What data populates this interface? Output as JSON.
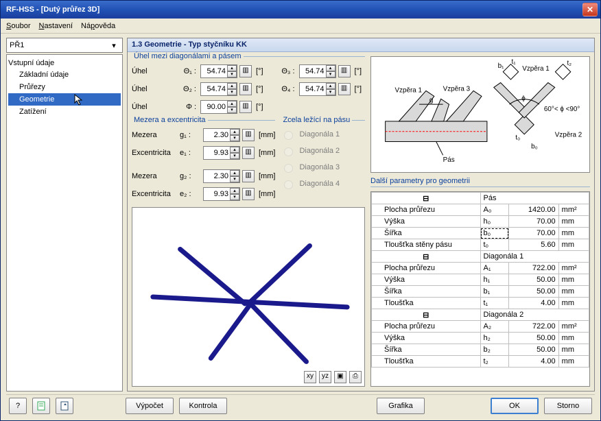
{
  "window": {
    "title": "RF-HSS - [Dutý průřez 3D]"
  },
  "menu": {
    "file": "Soubor",
    "settings": "Nastavení",
    "help": "Nápověda"
  },
  "case_selector": "PŘ1",
  "header": "1.3 Geometrie - Typ styčníku KK",
  "tree": {
    "root": "Vstupní údaje",
    "items": [
      "Základní údaje",
      "Průřezy",
      "Geometrie",
      "Zatížení"
    ],
    "selected": "Geometrie"
  },
  "angles": {
    "title": "Úhel mezi diagonálami a pásem",
    "lbl": "Úhel",
    "unit": "[°]",
    "theta1": {
      "sym": "Θ₁ :",
      "val": "54.74"
    },
    "theta2": {
      "sym": "Θ₂ :",
      "val": "54.74"
    },
    "theta3": {
      "sym": "Θ₃ :",
      "val": "54.74"
    },
    "theta4": {
      "sym": "Θ₄ :",
      "val": "54.74"
    },
    "phi": {
      "sym": "Φ :",
      "val": "90.00"
    }
  },
  "gap": {
    "title": "Mezera a excentricita",
    "rows": [
      {
        "lbl": "Mezera",
        "sym": "g₁ :",
        "val": "2.30",
        "unit": "[mm]"
      },
      {
        "lbl": "Excentricita",
        "sym": "e₁ :",
        "val": "9.93",
        "unit": "[mm]"
      },
      {
        "lbl": "Mezera",
        "sym": "g₂ :",
        "val": "2.30",
        "unit": "[mm]"
      },
      {
        "lbl": "Excentricita",
        "sym": "e₂ :",
        "val": "9.93",
        "unit": "[mm]"
      }
    ]
  },
  "zcela": {
    "title": "Zcela ležící na pásu",
    "opts": [
      "Diagonála 1",
      "Diagonála 2",
      "Diagonála 3",
      "Diagonála 4"
    ]
  },
  "diagram": {
    "vzpera1": "Vzpěra 1",
    "vzpera2": "Vzpěra 2",
    "vzpera3": "Vzpěra 3",
    "pas": "Pás",
    "b0": "b₀",
    "t0": "t₀",
    "b1": "b₁",
    "t1": "t₁",
    "t2": "t₂",
    "g": "g",
    "phi": "ϕ",
    "angle_note": "60°< ϕ <90°"
  },
  "params": {
    "title": "Další parametry pro geometrii",
    "groups": [
      {
        "name": "Pás",
        "rows": [
          {
            "name": "Plocha průřezu",
            "sym": "A₀",
            "val": "1420.00",
            "un": "mm²"
          },
          {
            "name": "Výška",
            "sym": "h₀",
            "val": "70.00",
            "un": "mm"
          },
          {
            "name": "Šířka",
            "sym": "b₀",
            "val": "70.00",
            "un": "mm"
          },
          {
            "name": "Tloušťka stěny pásu",
            "sym": "t₀",
            "val": "5.60",
            "un": "mm"
          }
        ]
      },
      {
        "name": "Diagonála 1",
        "rows": [
          {
            "name": "Plocha průřezu",
            "sym": "A₁",
            "val": "722.00",
            "un": "mm²"
          },
          {
            "name": "Výška",
            "sym": "h₁",
            "val": "50.00",
            "un": "mm"
          },
          {
            "name": "Šířka",
            "sym": "b₁",
            "val": "50.00",
            "un": "mm"
          },
          {
            "name": "Tloušťka",
            "sym": "t₁",
            "val": "4.00",
            "un": "mm"
          }
        ]
      },
      {
        "name": "Diagonála 2",
        "rows": [
          {
            "name": "Plocha průřezu",
            "sym": "A₂",
            "val": "722.00",
            "un": "mm²"
          },
          {
            "name": "Výška",
            "sym": "h₂",
            "val": "50.00",
            "un": "mm"
          },
          {
            "name": "Šířka",
            "sym": "b₂",
            "val": "50.00",
            "un": "mm"
          },
          {
            "name": "Tloušťka",
            "sym": "t₂",
            "val": "4.00",
            "un": "mm"
          }
        ]
      }
    ]
  },
  "buttons": {
    "compute": "Výpočet",
    "check": "Kontrola",
    "grafik": "Grafika",
    "ok": "OK",
    "storno": "Storno"
  }
}
